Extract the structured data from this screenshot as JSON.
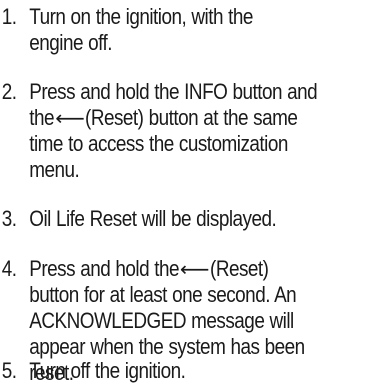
{
  "steps": [
    {
      "number": "1.",
      "lines": [
        "Turn on the ignition, with the",
        "engine off."
      ]
    },
    {
      "number": "2.",
      "lines": [
        "Press and hold the INFO button and",
        "the",
        "(Reset) button at the same",
        "time to access the customization",
        "menu."
      ]
    },
    {
      "number": "3.",
      "lines": [
        "Oil Life Reset will be displayed."
      ]
    },
    {
      "number": "4.",
      "lines": [
        "Press and hold the",
        "(Reset)",
        "button for at least one second. An",
        "ACKNOWLEDGED message will",
        "appear when the system has been",
        "reset."
      ]
    },
    {
      "number": "5.",
      "lines": [
        "Turn off the ignition."
      ]
    }
  ],
  "icons": {
    "reset": "return-arrow-icon",
    "reset_glyph": "⟵"
  }
}
